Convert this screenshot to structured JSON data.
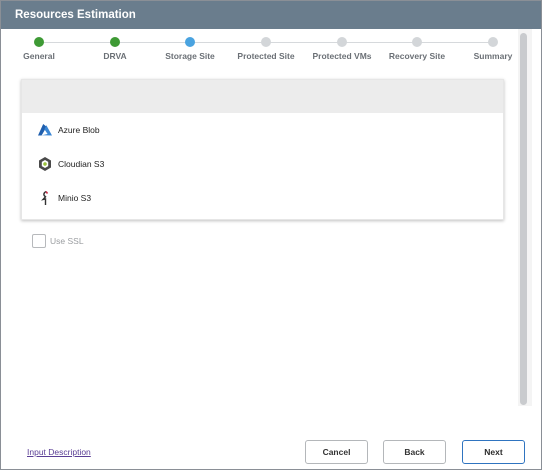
{
  "window": {
    "title": "Resources Estimation"
  },
  "stepper": {
    "steps": [
      {
        "label": "General",
        "state": "done"
      },
      {
        "label": "DRVA",
        "state": "done"
      },
      {
        "label": "Storage Site",
        "state": "current"
      },
      {
        "label": "Protected Site",
        "state": "pending"
      },
      {
        "label": "Protected VMs",
        "state": "pending"
      },
      {
        "label": "Recovery Site",
        "state": "pending"
      },
      {
        "label": "Summary",
        "state": "pending"
      }
    ],
    "colors": {
      "done": "#3e9a35",
      "current": "#4aa3e0",
      "pending": "#d3d6d9"
    }
  },
  "storage_list": {
    "items": [
      {
        "label": "Azure Blob",
        "icon": "azure-icon"
      },
      {
        "label": "Cloudian S3",
        "icon": "cloudian-icon"
      },
      {
        "label": "Minio S3",
        "icon": "minio-icon"
      }
    ]
  },
  "options": {
    "use_ssl_label": "Use SSL",
    "use_ssl_checked": false
  },
  "footer": {
    "input_description_link": "Input Description",
    "cancel_label": "Cancel",
    "back_label": "Back",
    "next_label": "Next"
  },
  "colors": {
    "titlebar": "#6a7d8d",
    "accent": "#2f74c0",
    "link": "#5a3e95"
  }
}
